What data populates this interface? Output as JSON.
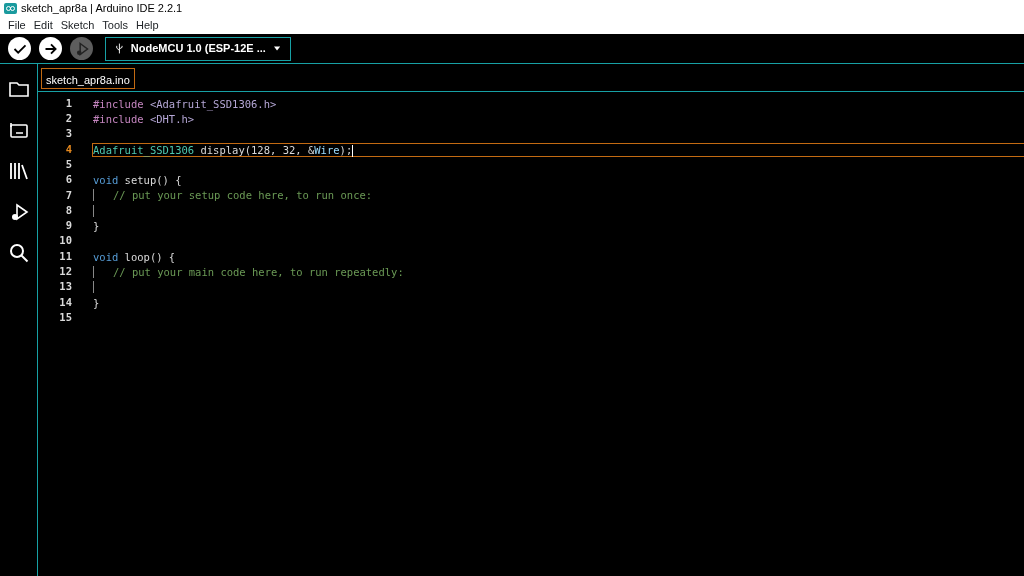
{
  "window": {
    "title": "sketch_apr8a | Arduino IDE 2.2.1"
  },
  "menu": [
    "File",
    "Edit",
    "Sketch",
    "Tools",
    "Help"
  ],
  "toolbar": {
    "buttons": [
      {
        "kind": "verify",
        "disabled": false
      },
      {
        "kind": "upload",
        "disabled": false
      },
      {
        "kind": "debug",
        "disabled": true
      }
    ],
    "board": "NodeMCU 1.0 (ESP-12E ..."
  },
  "sidebar": {
    "items": [
      {
        "kind": "folder"
      },
      {
        "kind": "boards"
      },
      {
        "kind": "library"
      },
      {
        "kind": "debug"
      },
      {
        "kind": "search"
      }
    ]
  },
  "tabs": [
    {
      "label": "sketch_apr8a.ino",
      "selected": true
    }
  ],
  "editor": {
    "lines": [
      {
        "number": "1",
        "tokens": [
          {
            "kind": "preproc",
            "text": "#include "
          },
          {
            "kind": "header",
            "text": "<Adafruit_SSD1306.h>"
          }
        ]
      },
      {
        "number": "2",
        "tokens": [
          {
            "kind": "preproc",
            "text": "#include "
          },
          {
            "kind": "header",
            "text": "<DHT.h>"
          }
        ]
      },
      {
        "number": "3"
      },
      {
        "number": "4",
        "current": true,
        "tokens": [
          {
            "kind": "type",
            "text": "Adafruit_SSD1306"
          },
          {
            "kind": "plain",
            "text": " display(128, 32, &"
          },
          {
            "kind": "variable",
            "text": "Wire"
          },
          {
            "kind": "plain",
            "text": ");"
          }
        ]
      },
      {
        "number": "5"
      },
      {
        "number": "6",
        "tokens": [
          {
            "kind": "keyword",
            "text": "void"
          },
          {
            "kind": "plain",
            "text": " setup() {"
          }
        ]
      },
      {
        "number": "7",
        "guide": true,
        "tokens": [
          {
            "kind": "comment",
            "text": "// put your setup code here, to run once:"
          }
        ]
      },
      {
        "number": "8",
        "guide": true
      },
      {
        "number": "9",
        "tokens": [
          {
            "kind": "plain",
            "text": "}"
          }
        ]
      },
      {
        "number": "10"
      },
      {
        "number": "11",
        "tokens": [
          {
            "kind": "keyword",
            "text": "void"
          },
          {
            "kind": "plain",
            "text": " loop() {"
          }
        ]
      },
      {
        "number": "12",
        "guide": true,
        "tokens": [
          {
            "kind": "comment",
            "text": "// put your main code here, to run repeatedly:"
          }
        ]
      },
      {
        "number": "13",
        "guide": true
      },
      {
        "number": "14",
        "tokens": [
          {
            "kind": "plain",
            "text": "}"
          }
        ]
      },
      {
        "number": "15"
      }
    ]
  }
}
